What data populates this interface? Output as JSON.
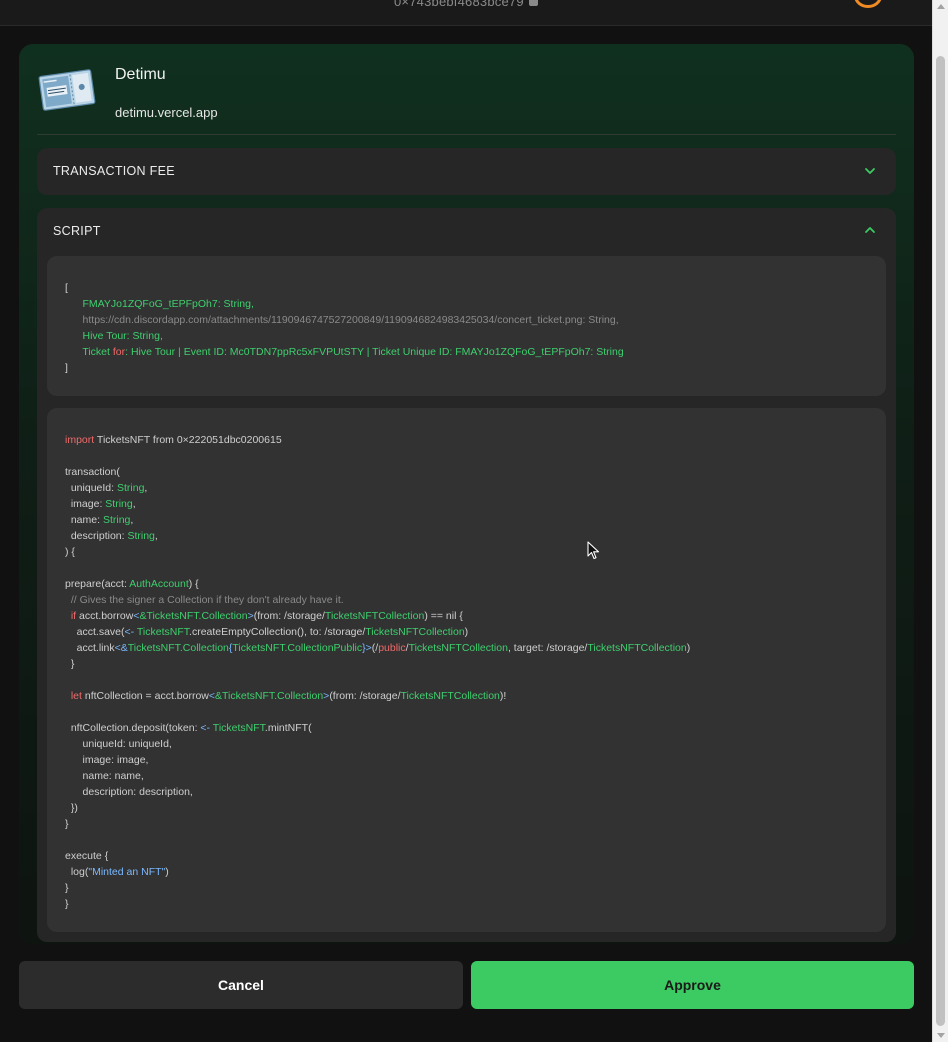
{
  "topbar": {
    "address": "0×743bebf4683bce79",
    "icons": [
      "copy-icon",
      "avatar"
    ]
  },
  "app": {
    "name": "Detimu",
    "url": "detimu.vercel.app",
    "icon": "ticket-icon"
  },
  "sections": {
    "fee": {
      "title": "TRANSACTION FEE",
      "icon": "chevron-down-icon"
    },
    "script": {
      "title": "SCRIPT",
      "icon": "chevron-up-icon"
    }
  },
  "args": {
    "open": "[",
    "arg1": "FMAYJo1ZQFoG_tEPFpOh7: String,",
    "arg2_url": "https://cdn.discordapp.com/attachments/1190946747527200849/1190946824983425034/concert_ticket.png",
    "arg2_type": ": String,",
    "arg3": "Hive Tour: String,",
    "arg4_prefix": "Ticket",
    "arg4_for": "for",
    "arg4_rest": ": Hive Tour | Event ID: Mc0TDN7ppRc5xFVPUtSTY | Ticket Unique ID: FMAYJo1ZQFoG_tEPFpOh7: String",
    "close": "]"
  },
  "code": {
    "import_kw": "import",
    "import_rest": "TicketsNFT from 0×222051dbc0200615",
    "transaction_open": "transaction(",
    "p_uniqueId": "uniqueId:",
    "p_image": "image:",
    "p_name": "name:",
    "p_description": "description:",
    "type_string": "String",
    "comma": ",",
    "transaction_close": ") {",
    "prepare_open": "prepare(acct:",
    "prepare_type": "AuthAccount",
    "prepare_brace": ") {",
    "comment": "// Gives the signer a Collection if they don't already have it.",
    "if_kw": "if",
    "if_acct": "acct.borrow",
    "lt": "<",
    "amp_tickets": "&TicketsNFT.Collection",
    "gt": ">",
    "from_storage": "(from: /storage/",
    "tickets_nft_collection": "TicketsNFTCollection",
    "eq_nil": ") == nil {",
    "save_start": "acct.save(",
    "arrow": "<-",
    "tickets_nft": "TicketsNFT",
    "create_rest": ".createEmptyCollection(), to: /storage/",
    "close_paren": ")",
    "link_start": "acct.link",
    "lt_amp": "<&",
    "tickets_coll": "TicketsNFT.Collection",
    "curly_open": "{",
    "coll_public": "TicketsNFT.CollectionPublic",
    "curly_gt": "}>",
    "slash_open": "(/",
    "public_kw": "public",
    "slash": "/",
    "target_rest": ", target: /storage/",
    "brace_close": "}",
    "let_kw": "let",
    "let_rest": "nftCollection = acct.borrow",
    "from_paren": "(from: /storage/",
    "bang": ")!",
    "deposit_start": "nftCollection.deposit(token:",
    "mint_rest": ".mintNFT(",
    "a_uniqueId": "uniqueId: uniqueId,",
    "a_image": "image: image,",
    "a_name": "name: name,",
    "a_description": "description: description,",
    "paren_close": "})",
    "execute_open": "execute {",
    "log_start": "log(",
    "log_msg": "\"Minted an NFT\"",
    "final_close": "}"
  },
  "buttons": {
    "cancel": "Cancel",
    "approve": "Approve"
  },
  "colors": {
    "accent": "#3ccb62",
    "keyword": "#f06a6a",
    "type": "#3ecf6e",
    "punct": "#7bb8ff"
  }
}
